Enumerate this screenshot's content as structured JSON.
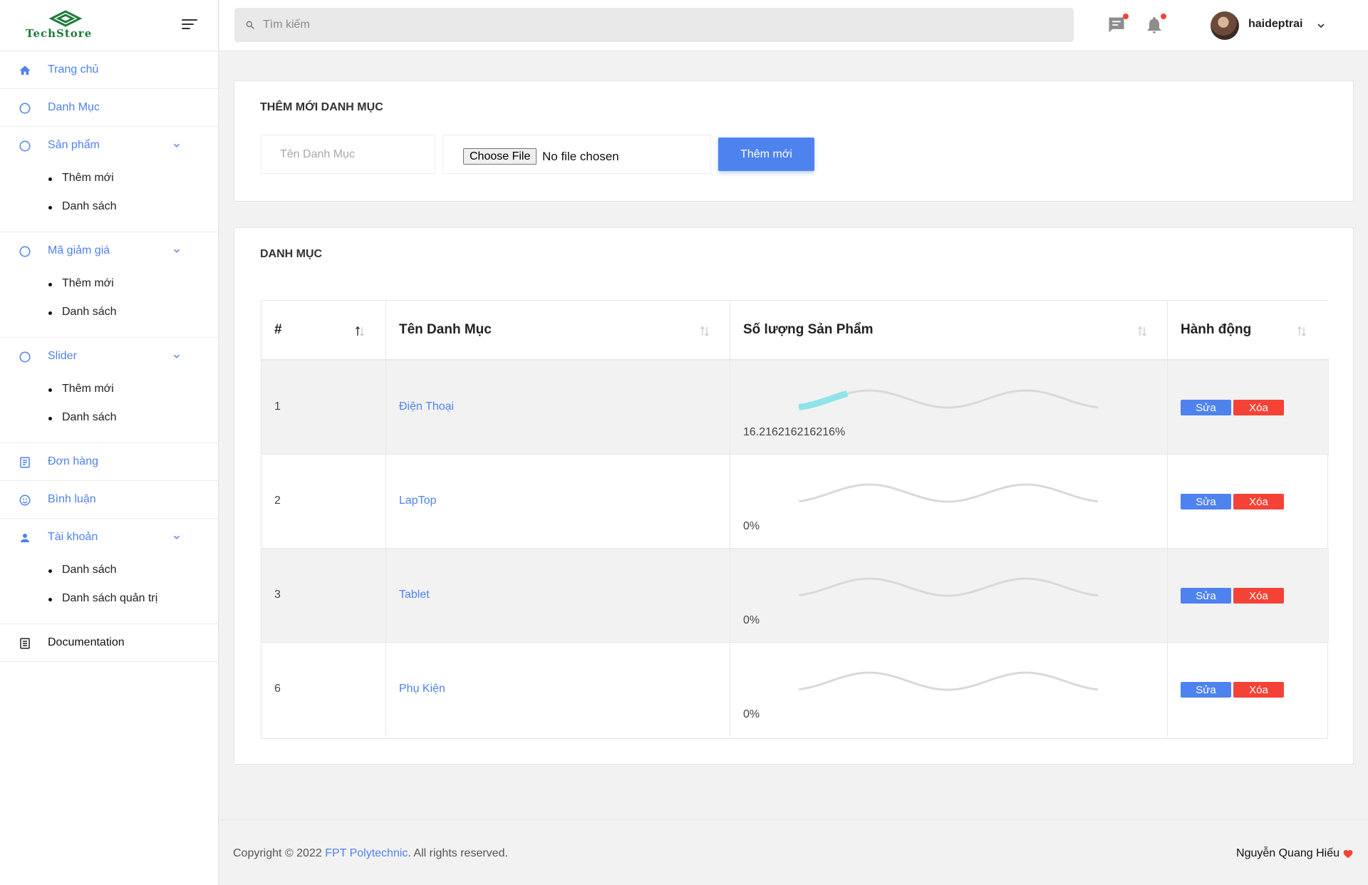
{
  "brand": {
    "name": "TechStore",
    "icon": "techstore-logo"
  },
  "sidebar": {
    "items": [
      {
        "label": "Trang chủ",
        "icon": "home-icon"
      },
      {
        "label": "Danh Mục",
        "icon": "circle-icon"
      },
      {
        "label": "Sản phẩm",
        "icon": "circle-icon",
        "children": [
          "Thêm mới",
          "Danh sách"
        ]
      },
      {
        "label": "Mã giảm giá",
        "icon": "circle-icon",
        "children": [
          "Thêm mới",
          "Danh sách"
        ]
      },
      {
        "label": "Slider",
        "icon": "circle-icon",
        "children": [
          "Thêm mới",
          "Danh sách"
        ]
      },
      {
        "label": "Đơn hàng",
        "icon": "list-alt-icon"
      },
      {
        "label": "Bình luận",
        "icon": "smile-icon"
      },
      {
        "label": "Tài khoản",
        "icon": "person-icon",
        "children": [
          "Danh sách",
          "Danh sách quản trị"
        ]
      },
      {
        "label": "Documentation",
        "icon": "document-icon"
      }
    ]
  },
  "topbar": {
    "search_placeholder": "Tìm kiếm",
    "username": "haideptrai"
  },
  "add_form": {
    "title": "THÊM MỚI DANH MỤC",
    "name_placeholder": "Tên Danh Mục",
    "file_button": "Choose File",
    "file_status": "No file chosen",
    "submit_label": "Thêm mới"
  },
  "category_table": {
    "title": "DANH MỤC",
    "columns": [
      "#",
      "Tên Danh Mục",
      "Số lượng Sản Phẩm",
      "Hành động"
    ],
    "rows": [
      {
        "id": "1",
        "name": "Điện Thoại",
        "percent_label": "16.216216216216%",
        "percent": 16.216216216216
      },
      {
        "id": "2",
        "name": "LapTop",
        "percent_label": "0%",
        "percent": 0
      },
      {
        "id": "3",
        "name": "Tablet",
        "percent_label": "0%",
        "percent": 0
      },
      {
        "id": "6",
        "name": "Phụ Kiện",
        "percent_label": "0%",
        "percent": 0
      }
    ],
    "edit_label": "Sửa",
    "delete_label": "Xóa"
  },
  "footer": {
    "copyright_prefix": "Copyright © 2022 ",
    "copyright_link": "FPT Polytechnic",
    "copyright_suffix": ". All rights reserved.",
    "author": "Nguyễn Quang Hiếu"
  },
  "colors": {
    "accent": "#4e82ef",
    "danger": "#f44336",
    "wave_progress": "#8fe3ea",
    "wave_track": "#d9d9d9",
    "brand_green": "#1f7a3a"
  }
}
